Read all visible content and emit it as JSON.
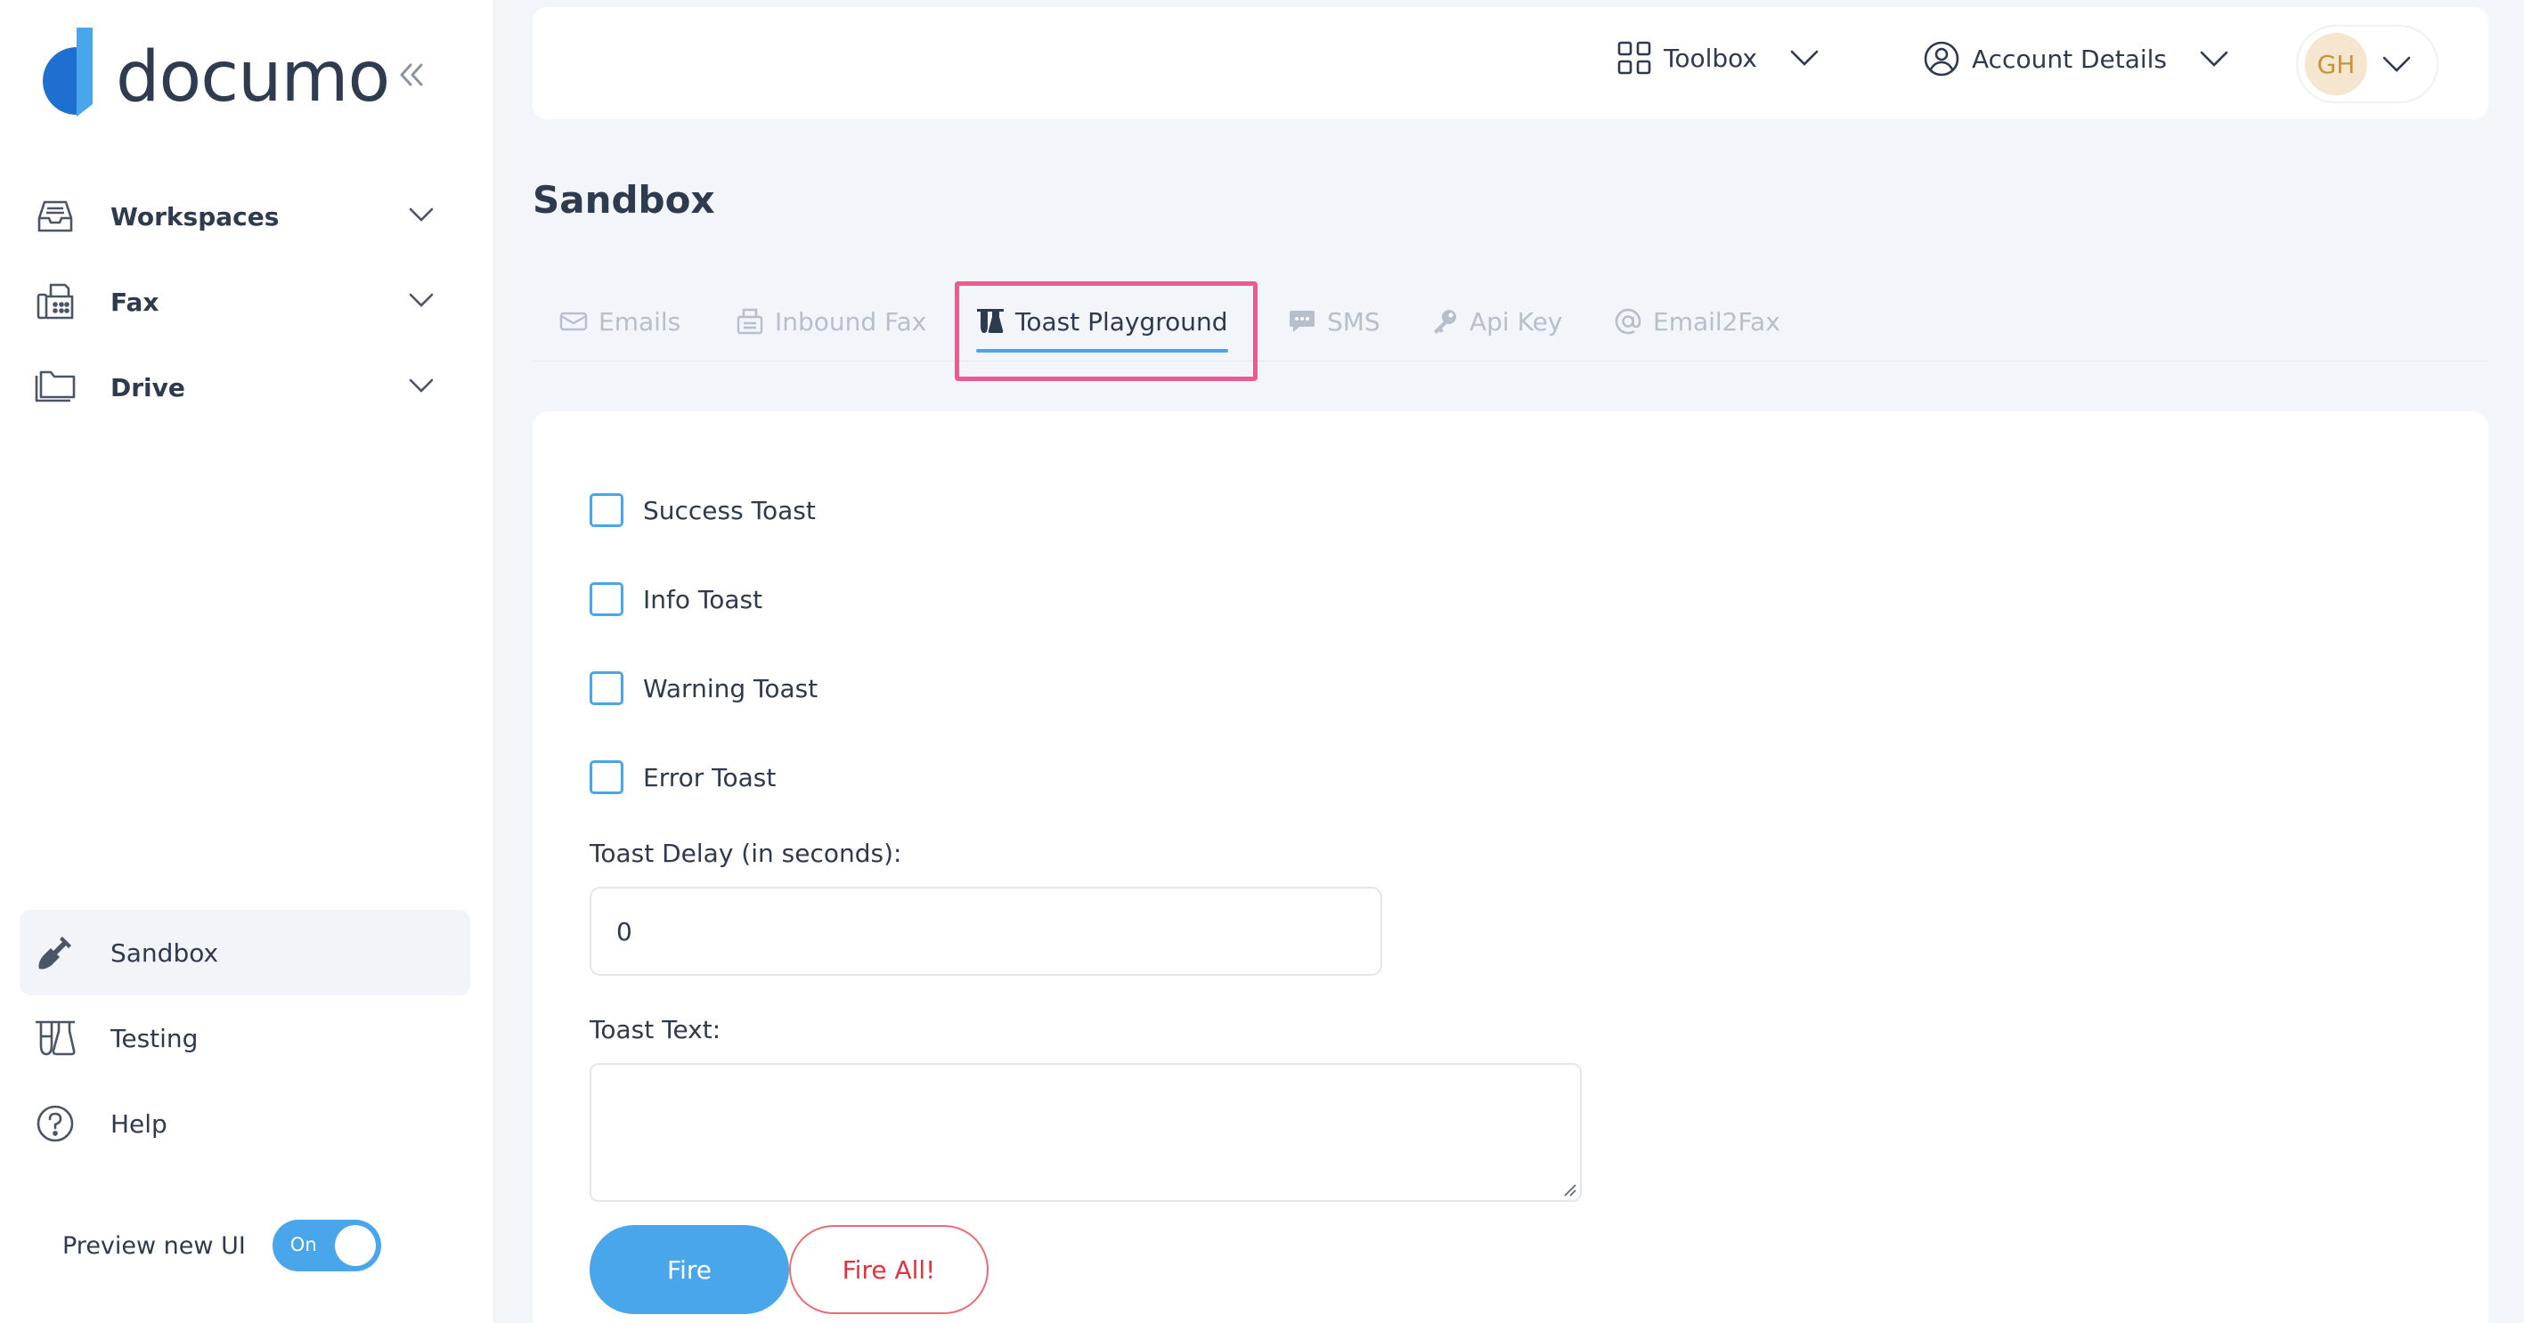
{
  "brand": {
    "name": "documo",
    "primary_color": "#1f6fd0",
    "accent_color": "#4aa6ea"
  },
  "sidebar": {
    "collapse_icon": "double-chevron-left-icon",
    "items": [
      {
        "label": "Workspaces",
        "icon": "inbox-tray-icon",
        "expandable": true
      },
      {
        "label": "Fax",
        "icon": "fax-machine-icon",
        "expandable": true
      },
      {
        "label": "Drive",
        "icon": "folder-icon",
        "expandable": true
      },
      {
        "label": "Sandbox",
        "icon": "shovel-icon",
        "active": true
      },
      {
        "label": "Testing",
        "icon": "flask-icon"
      },
      {
        "label": "Help",
        "icon": "question-circle-icon"
      }
    ],
    "preview": {
      "label": "Preview new UI",
      "toggle_text": "On",
      "enabled": true
    }
  },
  "topbar": {
    "toolbox_label": "Toolbox",
    "account_label": "Account Details",
    "avatar_initials": "GH"
  },
  "page": {
    "title": "Sandbox",
    "tabs": [
      {
        "label": "Emails",
        "icon": "email-icon"
      },
      {
        "label": "Inbound Fax",
        "icon": "fax-icon"
      },
      {
        "label": "Toast Playground",
        "icon": "flask-icon",
        "active": true
      },
      {
        "label": "SMS",
        "icon": "chat-bubble-icon"
      },
      {
        "label": "Api Key",
        "icon": "key-icon"
      },
      {
        "label": "Email2Fax",
        "icon": "at-sign-icon"
      }
    ]
  },
  "form": {
    "checkboxes": [
      {
        "label": "Success Toast",
        "checked": false
      },
      {
        "label": "Info Toast",
        "checked": false
      },
      {
        "label": "Warning Toast",
        "checked": false
      },
      {
        "label": "Error Toast",
        "checked": false
      }
    ],
    "delay_label": "Toast Delay (in seconds):",
    "delay_value": "0",
    "text_label": "Toast Text:",
    "text_value": "",
    "fire_label": "Fire",
    "fire_all_label": "Fire All!"
  }
}
